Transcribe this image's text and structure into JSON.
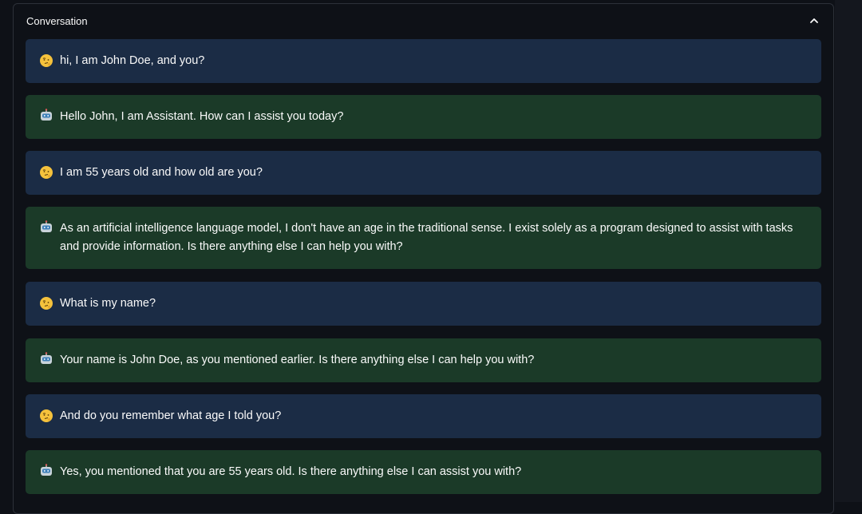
{
  "expander": {
    "title": "Conversation",
    "icon": "chevron-up-icon"
  },
  "colors": {
    "background": "#0e1117",
    "user_bubble": "#1b2c45",
    "assistant_bubble": "#1b3a28",
    "text": "#fafafa"
  },
  "messages": [
    {
      "role": "user",
      "avatar": "thinking-face-icon",
      "text": "hi, I am John Doe, and you?"
    },
    {
      "role": "assistant",
      "avatar": "robot-icon",
      "text": "Hello John, I am Assistant. How can I assist you today?"
    },
    {
      "role": "user",
      "avatar": "thinking-face-icon",
      "text": "I am 55 years old and how old are you?"
    },
    {
      "role": "assistant",
      "avatar": "robot-icon",
      "text": "As an artificial intelligence language model, I don't have an age in the traditional sense. I exist solely as a program designed to assist with tasks and provide information. Is there anything else I can help you with?"
    },
    {
      "role": "user",
      "avatar": "thinking-face-icon",
      "text": "What is my name?"
    },
    {
      "role": "assistant",
      "avatar": "robot-icon",
      "text": "Your name is John Doe, as you mentioned earlier. Is there anything else I can help you with?"
    },
    {
      "role": "user",
      "avatar": "thinking-face-icon",
      "text": "And do you remember what age I told you?"
    },
    {
      "role": "assistant",
      "avatar": "robot-icon",
      "text": "Yes, you mentioned that you are 55 years old. Is there anything else I can assist you with?"
    }
  ]
}
